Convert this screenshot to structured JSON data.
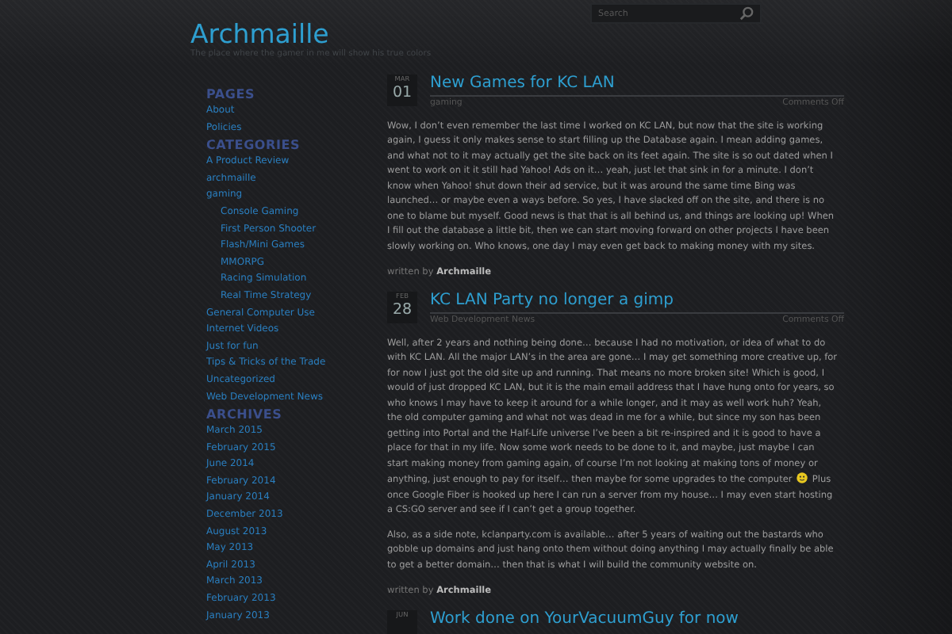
{
  "site": {
    "title": "Archmaille",
    "tagline": "The place where the gamer in me will show his true colors",
    "search": {
      "placeholder": "Search"
    }
  },
  "sidebar": [
    {
      "heading": "PAGES",
      "items": [
        {
          "label": "About"
        },
        {
          "label": "Policies"
        }
      ]
    },
    {
      "heading": "CATEGORIES",
      "items": [
        {
          "label": "A Product Review"
        },
        {
          "label": "archmaille"
        },
        {
          "label": "gaming",
          "children": [
            {
              "label": "Console Gaming"
            },
            {
              "label": "First Person Shooter"
            },
            {
              "label": "Flash/Mini Games"
            },
            {
              "label": "MMORPG"
            },
            {
              "label": "Racing Simulation"
            },
            {
              "label": "Real Time Strategy"
            }
          ]
        },
        {
          "label": "General Computer Use"
        },
        {
          "label": "Internet Videos"
        },
        {
          "label": "Just for fun"
        },
        {
          "label": "Tips & Tricks of the Trade"
        },
        {
          "label": "Uncategorized"
        },
        {
          "label": "Web Development News"
        }
      ]
    },
    {
      "heading": "ARCHIVES",
      "items": [
        {
          "label": "March 2015"
        },
        {
          "label": "February 2015"
        },
        {
          "label": "June 2014"
        },
        {
          "label": "February 2014"
        },
        {
          "label": "January 2014"
        },
        {
          "label": "December 2013"
        },
        {
          "label": "August 2013"
        },
        {
          "label": "May 2013"
        },
        {
          "label": "April 2013"
        },
        {
          "label": "March 2013"
        },
        {
          "label": "February 2013"
        },
        {
          "label": "January 2013"
        }
      ]
    }
  ],
  "posts": [
    {
      "month": "MAR",
      "day": "01",
      "title": "New Games for KC LAN",
      "category": "gaming",
      "comments": "Comments Off",
      "paragraphs": [
        [
          {
            "kind": "text",
            "text": "Wow, I don’t even remember the last time I worked on KC LAN, but now that the site is working again, I guess it only makes sense to start filling up the Database again.  I mean adding games, and what not to it may actually get the site back on its feet again.  The site is so out dated when I went to work on it it still had Yahoo! Ads on it… yeah, just let that sink in for a minute.  I don’t know when Yahoo! shut down their ad service, but it was around the same time Bing was launched… or maybe even a ways before.  So yes, I have slacked off on the site, and there is no one to blame but myself.  Good news is that that is all behind us, and things are looking up!  When I fill out the database a little bit, then we can start moving forward on other projects I have been slowly working on.  Who knows, one day I may even get back to making money with my sites."
          }
        ]
      ],
      "written_by": "written by",
      "author": "Archmaille"
    },
    {
      "month": "FEB",
      "day": "28",
      "title": "KC LAN Party no longer a gimp",
      "category": "Web Development News",
      "comments": "Comments Off",
      "paragraphs": [
        [
          {
            "kind": "text",
            "text": "Well, after 2 years and nothing being done… because I had no motivation, or idea of what to do with KC LAN.  All the major LAN’s in the area are gone… I may get something more creative up, for for now I just got the old site up and running.  That means no more broken site!  Which is good, I would of just dropped KC LAN, but it is the main email address that I have hung onto for years, so who knows I may have to keep it around for a while longer, and it may as well work huh?  Yeah, the old computer gaming and what not was dead in me for a while, but since my son has been getting into Portal and the Half-Life universe I’ve been a bit re-inspired and it is good to have a place for that in my life.  Now some work needs to be done to it, and maybe, just maybe I can start making money from gaming again, of course I’m not looking at making tons of money or anything, just enough to pay for itself… then maybe for some upgrades to the computer"
          },
          {
            "kind": "smiley"
          },
          {
            "kind": "text",
            "text": "Plus once Google Fiber is hooked up here I can run a server from my house… I may even start hosting a CS:GO server and see if I can’t get a group together."
          }
        ],
        [
          {
            "kind": "text",
            "text": "Also, as a side note, kclanparty.com is available… after 5 years of waiting out the bastards who gobble up domains and just hang onto them without doing anything I may actually finally be able to get a better domain… then that is what I will build the community website on."
          }
        ]
      ],
      "written_by": "written by",
      "author": "Archmaille"
    },
    {
      "month": "JUN",
      "title": "Work done on YourVacuumGuy for now"
    }
  ]
}
